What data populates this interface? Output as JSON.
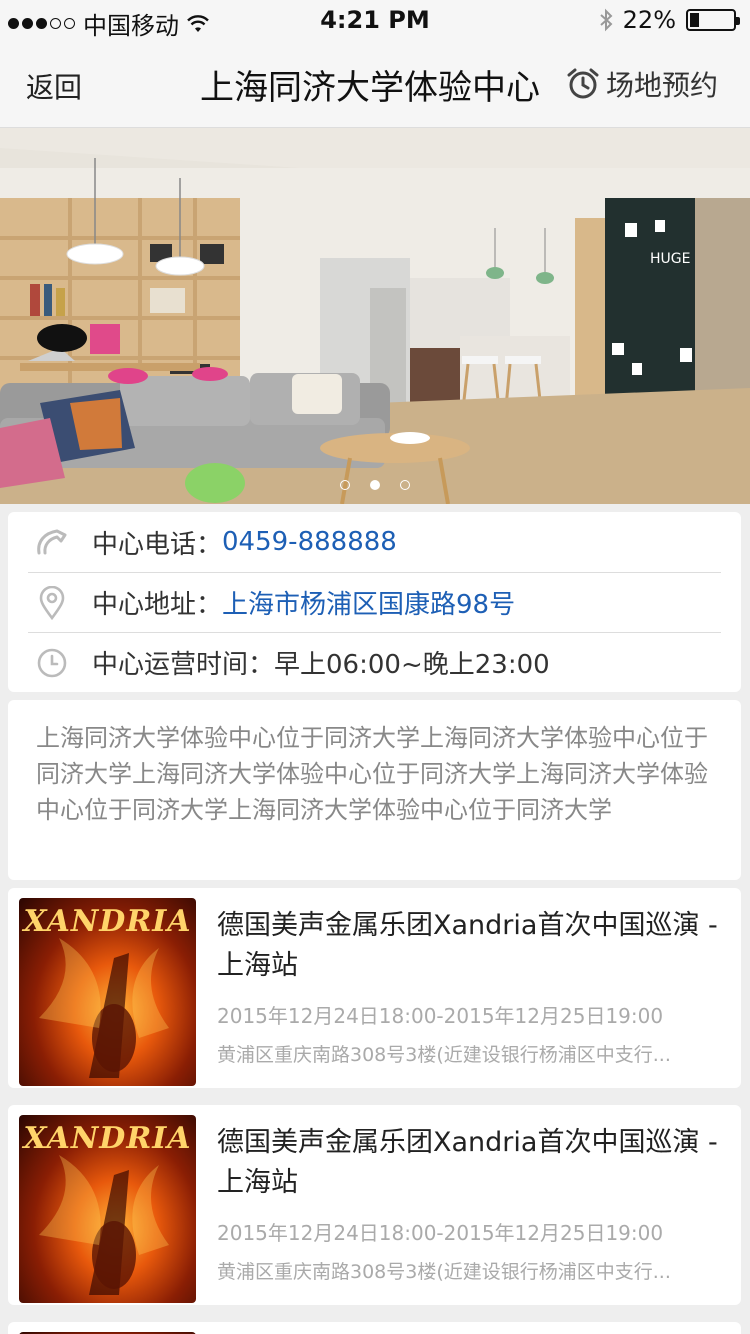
{
  "status_bar": {
    "carrier": "中国移动",
    "time": "4:21 PM",
    "battery": "22%",
    "battery_level": 0.22
  },
  "nav": {
    "back": "返回",
    "title": "上海同济大学体验中心",
    "action": "场地预约"
  },
  "hero": {
    "page_count": 3,
    "active_page": 2
  },
  "info": {
    "phone_label": "中心电话：",
    "phone_value": "0459-888888",
    "address_label": "中心地址：",
    "address_value": "上海市杨浦区国康路98号",
    "hours_label": "中心运营时间：",
    "hours_value": "早上06:00~晚上23:00"
  },
  "description": "上海同济大学体验中心位于同济大学上海同济大学体验中心位于同济大学上海同济大学体验中心位于同济大学上海同济大学体验中心位于同济大学上海同济大学体验中心位于同济大学",
  "events": [
    {
      "poster_text": "XANDRIA",
      "title": "德国美声金属乐团Xandria首次中国巡演 - 上海站",
      "date": "2015年12月24日18:00-2015年12月25日19:00",
      "address": "黄浦区重庆南路308号3楼(近建设银行杨浦区中支行..."
    },
    {
      "poster_text": "XANDRIA",
      "title": "德国美声金属乐团Xandria首次中国巡演 - 上海站",
      "date": "2015年12月24日18:00-2015年12月25日19:00",
      "address": "黄浦区重庆南路308号3楼(近建设银行杨浦区中支行..."
    }
  ],
  "colors": {
    "link": "#1d5fb5",
    "muted": "#aaaaaa"
  }
}
